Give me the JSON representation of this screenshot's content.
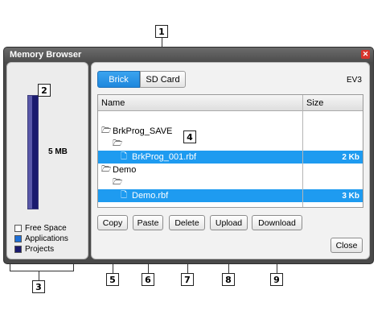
{
  "window": {
    "title": "Memory Browser"
  },
  "memory": {
    "used_label": "5 MB",
    "legend": [
      {
        "label": "Free Space",
        "color": "#ffffff"
      },
      {
        "label": "Applications",
        "color": "#1e6fd6"
      },
      {
        "label": "Projects",
        "color": "#1a1a6e"
      }
    ]
  },
  "tabs": [
    {
      "label": "Brick",
      "active": true
    },
    {
      "label": "SD Card",
      "active": false
    }
  ],
  "device_label": "EV3",
  "table": {
    "headers": [
      "Name",
      "Size"
    ],
    "rows": [
      {
        "name": "BrkProg_SAVE",
        "size": "",
        "selected": false,
        "icon": "folder-open-icon",
        "indent": 0
      },
      {
        "name": "",
        "size": "",
        "selected": false,
        "icon": "folder-open-icon",
        "indent": 1
      },
      {
        "name": "BrkProg_001.rbf",
        "size": "2 Kb",
        "selected": true,
        "icon": "file-icon",
        "indent": 2
      },
      {
        "name": "Demo",
        "size": "",
        "selected": false,
        "icon": "folder-open-icon",
        "indent": 0
      },
      {
        "name": "",
        "size": "",
        "selected": false,
        "icon": "folder-open-icon",
        "indent": 1
      },
      {
        "name": "Demo.rbf",
        "size": "3 Kb",
        "selected": true,
        "icon": "file-icon",
        "indent": 2
      }
    ]
  },
  "buttons": {
    "copy": "Copy",
    "paste": "Paste",
    "delete": "Delete",
    "upload": "Upload",
    "download": "Download",
    "close": "Close"
  },
  "callouts": [
    "1",
    "2",
    "3",
    "4",
    "5",
    "6",
    "7",
    "8",
    "9"
  ]
}
